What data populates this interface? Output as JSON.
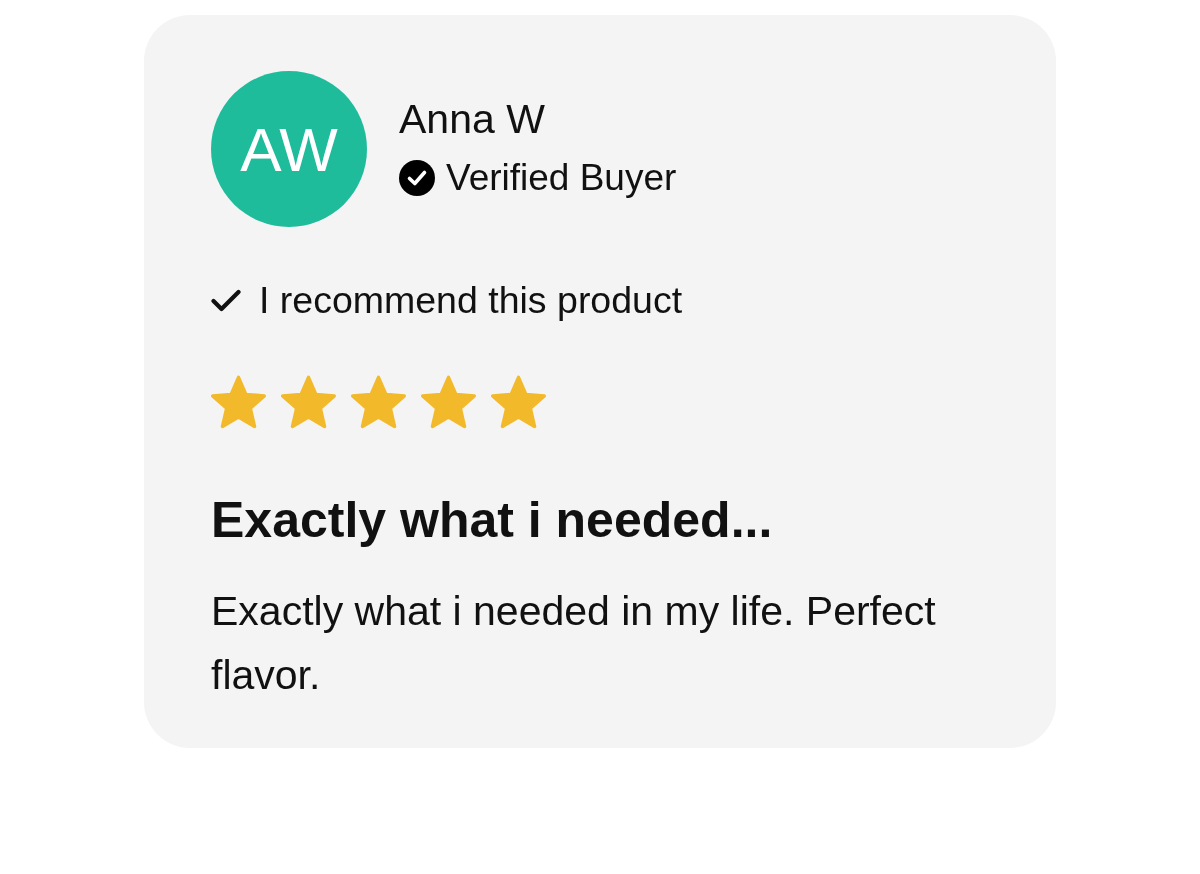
{
  "review": {
    "avatar": {
      "initials": "AW"
    },
    "author": "Anna W",
    "badge": "Verified Buyer",
    "recommendation": "I recommend this product",
    "stars": 5,
    "title": "Exactly what i needed...",
    "body": "Exactly what i needed in my life. Perfect flavor."
  }
}
